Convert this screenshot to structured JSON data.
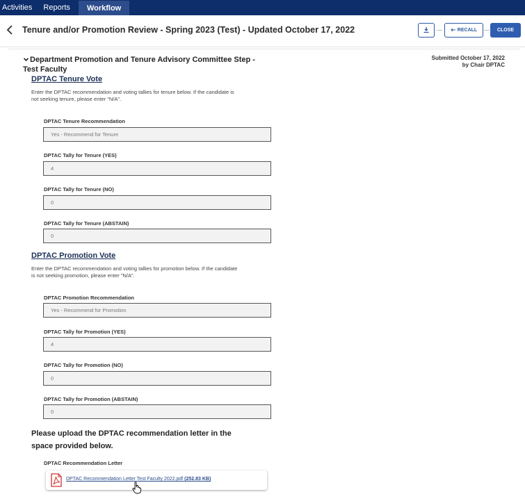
{
  "nav": {
    "tabs": [
      {
        "label": "Activities"
      },
      {
        "label": "Reports"
      },
      {
        "label": "Workflow"
      }
    ]
  },
  "header": {
    "title": "Tenure and/or Promotion Review - Spring 2023 (Test) - Updated October 17, 2022",
    "recall_label": "RECALL",
    "close_label": "CLOSE"
  },
  "section": {
    "title": "Department Promotion and Tenure Advisory Committee Step - Test Faculty",
    "submitted_line1": "Submitted October 17, 2022",
    "submitted_line2": "by Chair DPTAC"
  },
  "tenure": {
    "title": "DPTAC Tenure Vote",
    "instructions": "Enter the DPTAC recommendation and voting tallies for tenure below. If the candidate is not seeking tenure, please enter \"N/A\".",
    "fields": [
      {
        "label": "DPTAC Tenure Recommendation",
        "value": "Yes - Recommend for Tenure"
      },
      {
        "label": "DPTAC Tally for Tenure (YES)",
        "value": "4"
      },
      {
        "label": "DPTAC Tally for Tenure (NO)",
        "value": "0"
      },
      {
        "label": "DPTAC Tally for Tenure (ABSTAIN)",
        "value": "0"
      }
    ]
  },
  "promotion": {
    "title": "DPTAC Promotion Vote",
    "instructions": "Enter the DPTAC recommendation and voting tallies for promotion below. If the candidate is not seeking promotion, please enter \"N/A\".",
    "fields": [
      {
        "label": "DPTAC Promotion Recommendation",
        "value": "Yes - Recommend for Promotion"
      },
      {
        "label": "DPTAC Tally for Promotion (YES)",
        "value": "4"
      },
      {
        "label": "DPTAC Tally for Promotion (NO)",
        "value": "0"
      },
      {
        "label": "DPTAC Tally for Promotion (ABSTAIN)",
        "value": "0"
      }
    ]
  },
  "upload": {
    "heading": "Please upload the DPTAC recommendation letter in the space provided below.",
    "label": "DPTAC Recommendation Letter",
    "file_name": "DPTAC Recommendation Letter Test Faculty 2022.pdf",
    "file_size": "(252.83 KB)"
  },
  "icons": {
    "back": "chevron-left-icon",
    "download": "download-icon",
    "recall": "undo-arrow-icon",
    "section_toggle": "chevron-down-icon",
    "file": "pdf-icon",
    "cursor": "hand-pointer-icon"
  },
  "colors": {
    "nav_bg": "#0d2d6b",
    "accent": "#2f5eb0",
    "pdf_red": "#d32f2f"
  }
}
